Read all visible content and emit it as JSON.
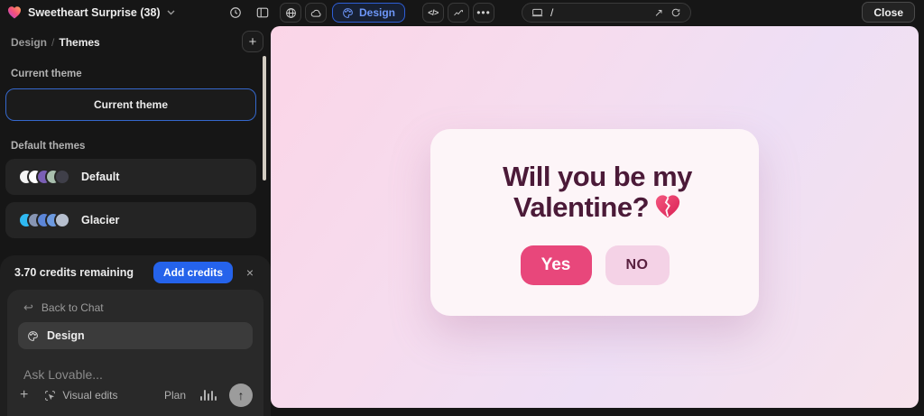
{
  "topbar": {
    "project_name": "Sweetheart Surprise (38)",
    "design_button_label": "Design",
    "url_path": "/",
    "close_label": "Close",
    "icons": [
      "lovable-heart-logo",
      "chevron-down",
      "history",
      "panel-left",
      "globe",
      "cloud",
      "palette",
      "code",
      "chart",
      "more-ellipsis",
      "device",
      "external-arrow",
      "refresh"
    ]
  },
  "sidebar": {
    "breadcrumb": {
      "parent": "Design",
      "separator": "/",
      "current": "Themes"
    },
    "add_theme_label": "+",
    "current_theme_section_label": "Current theme",
    "current_theme_button_label": "Current theme",
    "default_themes_section_label": "Default themes",
    "themes": [
      {
        "name": "Default",
        "colors": [
          "#f2f2f2",
          "#ffffff",
          "#7a5fb5",
          "#a8bfae",
          "#3f3f49"
        ]
      },
      {
        "name": "Glacier",
        "colors": [
          "#2fb9f2",
          "#8795b3",
          "#5c86d8",
          "#6d9ae0",
          "#b6bfce"
        ]
      }
    ]
  },
  "credits": {
    "remaining_text": "3.70 credits remaining",
    "add_button_label": "Add credits",
    "close_label": "×"
  },
  "chat": {
    "back_label": "Back to Chat",
    "mode_label": "Design",
    "input_placeholder": "Ask Lovable...",
    "add_label": "+",
    "visual_edits_label": "Visual edits",
    "plan_label": "Plan",
    "icons": [
      "return-arrow",
      "palette",
      "plus",
      "visual-edits-selector",
      "waveform",
      "arrow-up"
    ]
  },
  "preview": {
    "heading_text": "Will you be my Valentine?",
    "heading_emoji": "💔",
    "yes_label": "Yes",
    "no_label": "NO",
    "colors": {
      "yes_button": "#e8477b",
      "no_button": "#f4d2e6",
      "heading": "#4b1a38",
      "card_bg": "#fdf5f8",
      "gradient_start": "#fbd5e7",
      "gradient_end": "#f7e3ec"
    }
  },
  "app_colors": {
    "accent_blue": "#2563eb",
    "topbar_bg": "#161616"
  }
}
